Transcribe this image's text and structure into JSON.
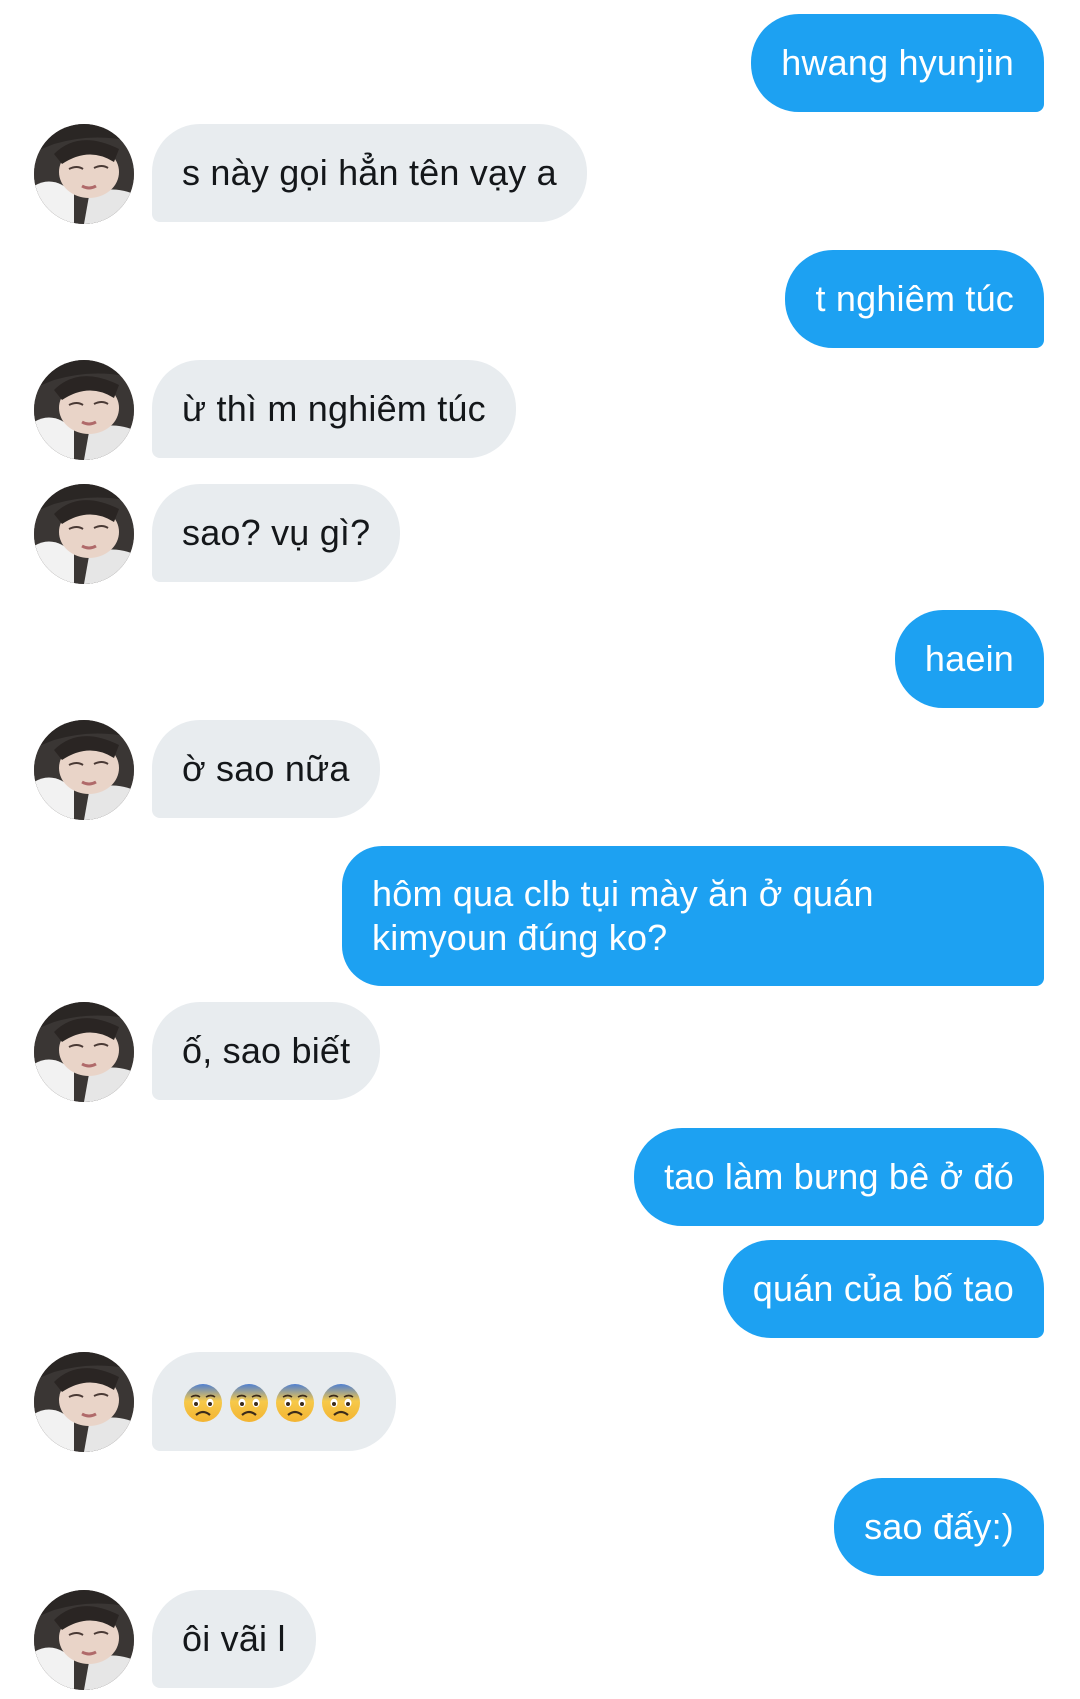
{
  "conversation": {
    "messages": [
      {
        "side": "out",
        "text": "hwang hyunjin"
      },
      {
        "side": "in",
        "text": "s này gọi hẳn tên vạy a"
      },
      {
        "side": "out",
        "text": "t nghiêm túc"
      },
      {
        "side": "in",
        "text": "ừ thì m nghiêm túc"
      },
      {
        "side": "in",
        "text": "sao? vụ gì?"
      },
      {
        "side": "out",
        "text": "haein"
      },
      {
        "side": "in",
        "text": "ờ sao nữa"
      },
      {
        "side": "out",
        "text": "hôm qua clb tụi mày ăn ở quán kimyoun đúng ko?"
      },
      {
        "side": "in",
        "text": "ố, sao biết"
      },
      {
        "side": "out",
        "text": "tao làm bưng bê ở đó"
      },
      {
        "side": "out",
        "text": "quán của bố tao"
      },
      {
        "side": "in",
        "emoji": [
          "anxious-face-icon",
          "anxious-face-icon",
          "anxious-face-icon",
          "anxious-face-icon"
        ]
      },
      {
        "side": "out",
        "text": "sao đấy:)"
      },
      {
        "side": "in",
        "text": "ôi vãi l"
      }
    ]
  },
  "colors": {
    "outgoing_bubble": "#1da1f2",
    "incoming_bubble": "#e8ecef",
    "outgoing_text": "#ffffff",
    "incoming_text": "#14171a"
  }
}
